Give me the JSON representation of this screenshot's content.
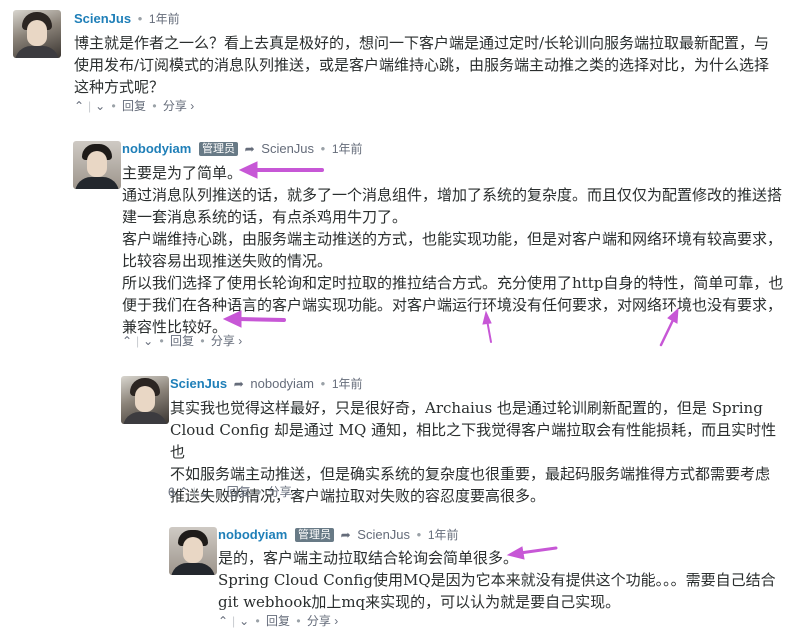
{
  "comments": [
    {
      "author": "ScienJus",
      "time": "1年前",
      "lines": [
        "博主就是作者之一么？看上去真是极好的，想问一下客户端是通过定时/长轮训向服务端拉取最新配置，与",
        "使用发布/订阅模式的消息队列推送，或是客户端维持心跳，由服务端主动推之类的选择对比，为什么选择",
        "这种方式呢？"
      ],
      "votes": "",
      "reply_label": "回复",
      "share_label": "分享 ›"
    },
    {
      "author": "nobodyiam",
      "badge": "管理员",
      "reply_to": "ScienJus",
      "time": "1年前",
      "lines": [
        "主要是为了简单。",
        "通过消息队列推送的话，就多了一个消息组件，增加了系统的复杂度。而且仅仅为配置修改的推送搭",
        "建一套消息系统的话，有点杀鸡用牛刀了。",
        "客户端维持心跳，由服务端主动推送的方式，也能实现功能，但是对客户端和网络环境有较高要求，",
        "比较容易出现推送失败的情况。",
        "所以我们选择了使用长轮询和定时拉取的推拉结合方式。充分使用了http自身的特性，简单可靠，也",
        "便于我们在各种语言的客户端实现功能。对客户端运行环境没有任何要求，对网络环境也没有要求，",
        "兼容性比较好。"
      ],
      "votes": "",
      "reply_label": "回复",
      "share_label": "分享 ›"
    },
    {
      "author": "ScienJus",
      "reply_to": "nobodyiam",
      "time": "1年前",
      "lines": [
        "其实我也觉得这样最好，只是很好奇，Archaius 也是通过轮训刷新配置的，但是 Spring",
        "Cloud Config 却是通过 MQ 通知，相比之下我觉得客户端拉取会有性能损耗，而且实时性也",
        "不如服务端主动推送，但是确实系统的复杂度也很重要，最起码服务端推得方式都需要考虑",
        "推送失败的情况，客户端拉取对失败的容忍度要高很多。"
      ],
      "votes": "6",
      "reply_label": "回复",
      "share_label": "分享 ›"
    },
    {
      "author": "nobodyiam",
      "badge": "管理员",
      "reply_to": "ScienJus",
      "time": "1年前",
      "lines": [
        "是的，客户端主动拉取结合轮询会简单很多。",
        "Spring Cloud Config使用MQ是因为它本来就没有提供这个功能。。。需要自己结合",
        "git webhook加上mq来实现的，可以认为就是要自己实现。"
      ],
      "votes": "",
      "reply_label": "回复",
      "share_label": "分享 ›"
    }
  ],
  "icons": {
    "upvote": "chevron-up-icon",
    "downvote": "chevron-down-icon",
    "reply_arrow": "reply-arrow-icon"
  },
  "colors": {
    "author": "#1f7fb8",
    "badge_bg": "#687a86",
    "annotation_arrow": "#c757d6",
    "meta_text": "#656c7a"
  }
}
